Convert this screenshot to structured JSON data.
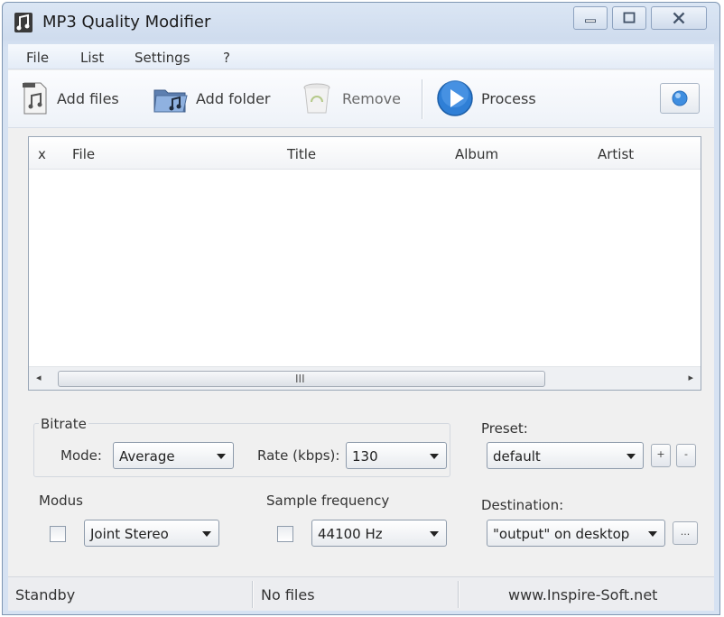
{
  "window": {
    "title": "MP3 Quality Modifier"
  },
  "menu": [
    {
      "label": "File"
    },
    {
      "label": "List"
    },
    {
      "label": "Settings"
    },
    {
      "label": "?"
    }
  ],
  "toolbar": {
    "add_files": "Add files",
    "add_folder": "Add folder",
    "remove": "Remove",
    "process": "Process"
  },
  "file_list": {
    "columns": [
      "x",
      "File",
      "Title",
      "Album",
      "Artist"
    ],
    "rows": [],
    "scroll_grip": "III"
  },
  "bitrate": {
    "group_label": "Bitrate",
    "mode_label": "Mode:",
    "mode_value": "Average",
    "rate_label": "Rate (kbps):",
    "rate_value": "130"
  },
  "modus": {
    "label": "Modus",
    "checked": false,
    "value": "Joint Stereo"
  },
  "sample_frequency": {
    "label": "Sample frequency",
    "checked": false,
    "value": "44100 Hz"
  },
  "preset": {
    "label": "Preset:",
    "value": "default",
    "add_label": "+",
    "remove_label": "-"
  },
  "destination": {
    "label": "Destination:",
    "value": "\"output\" on desktop",
    "browse_label": "..."
  },
  "status": {
    "state": "Standby",
    "files": "No files",
    "website": "www.Inspire-Soft.net"
  },
  "colors": {
    "accent": "#2f7fd6",
    "title_bar": "#dbe6f4"
  }
}
